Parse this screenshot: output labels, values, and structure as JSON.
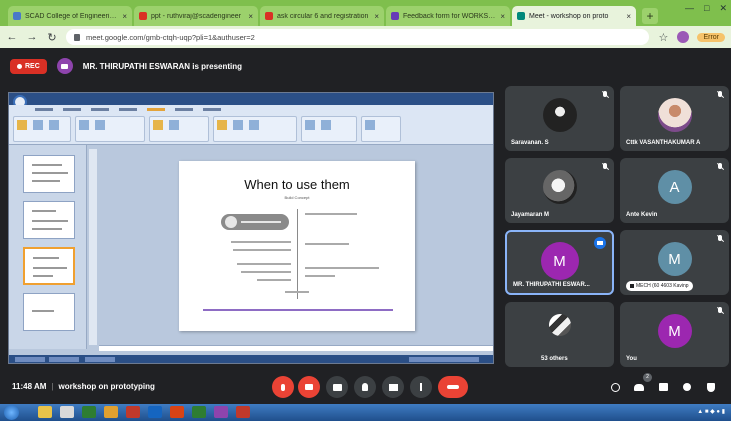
{
  "browser": {
    "tabs": [
      {
        "title": "SCAD College of Engineering & T",
        "favicon_color": "#4a78c9",
        "active": false
      },
      {
        "title": "ppt - ruthviraj@scadengineer",
        "favicon_color": "#d93025",
        "active": false
      },
      {
        "title": "ask circular 6 and registration",
        "favicon_color": "#d93025",
        "active": false
      },
      {
        "title": "Feedback form for WORKSHOP",
        "favicon_color": "#673ab7",
        "active": false
      },
      {
        "title": "Meet - workshop on proto",
        "favicon_color": "#00897b",
        "active": true
      }
    ],
    "url": "meet.google.com/gmb-ctqh-uqp?pli=1&authuser=2",
    "sync_label": "Error"
  },
  "meeting": {
    "rec_label": "REC",
    "presenting_text": "MR. THIRUPATHI ESWARAN is presenting",
    "time": "11:48 AM",
    "title": "workshop on prototyping"
  },
  "slide": {
    "title": "When to use them",
    "subtitle": "Build Concept"
  },
  "participants": [
    {
      "name": "Saravanan. S",
      "avatar": "photo1"
    },
    {
      "name": "Cttk VASANTHAKUMAR A",
      "avatar": "photo2"
    },
    {
      "name": "Jayamaran M",
      "avatar": "photo3"
    },
    {
      "name": "Ante Kevin",
      "avatar": "grey",
      "initial": "A"
    },
    {
      "name": "MR. THIRUPATHI ESWAR...",
      "avatar": "purple",
      "initial": "M"
    },
    {
      "name": "MECH (60 4603 Kavinp",
      "avatar": "grey",
      "initial": "M"
    },
    {
      "name": "53 others",
      "avatar": "photo4"
    },
    {
      "name": "You",
      "avatar": "purple2",
      "initial": "M"
    }
  ],
  "controls": {
    "notification_count": "2"
  },
  "colors": {
    "meet_bg": "#202124",
    "tile_bg": "#3c4043",
    "accent_red": "#ea4335",
    "browser_green": "#7fbf4d"
  }
}
